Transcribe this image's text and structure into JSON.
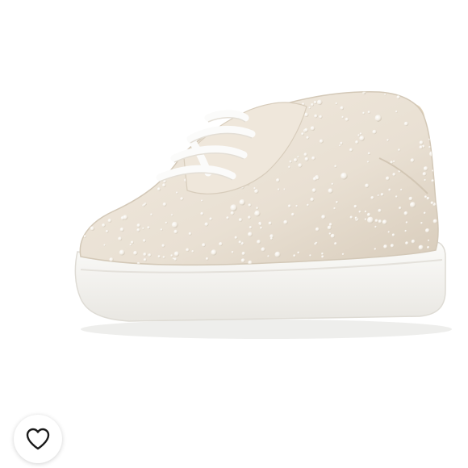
{
  "image": {
    "subject": "sneaker-icon",
    "colors": {
      "background": "#ffffff",
      "upper": "#ece4d8",
      "upper_shade": "#d9cfc0",
      "sole": "#f7f6f3",
      "lining": "#e3d3b8",
      "laces": "#fbfbfa",
      "pearl": "#ffffff"
    }
  },
  "like": {
    "icon": "heart-icon",
    "active": false,
    "color": "#1a1a1a"
  }
}
